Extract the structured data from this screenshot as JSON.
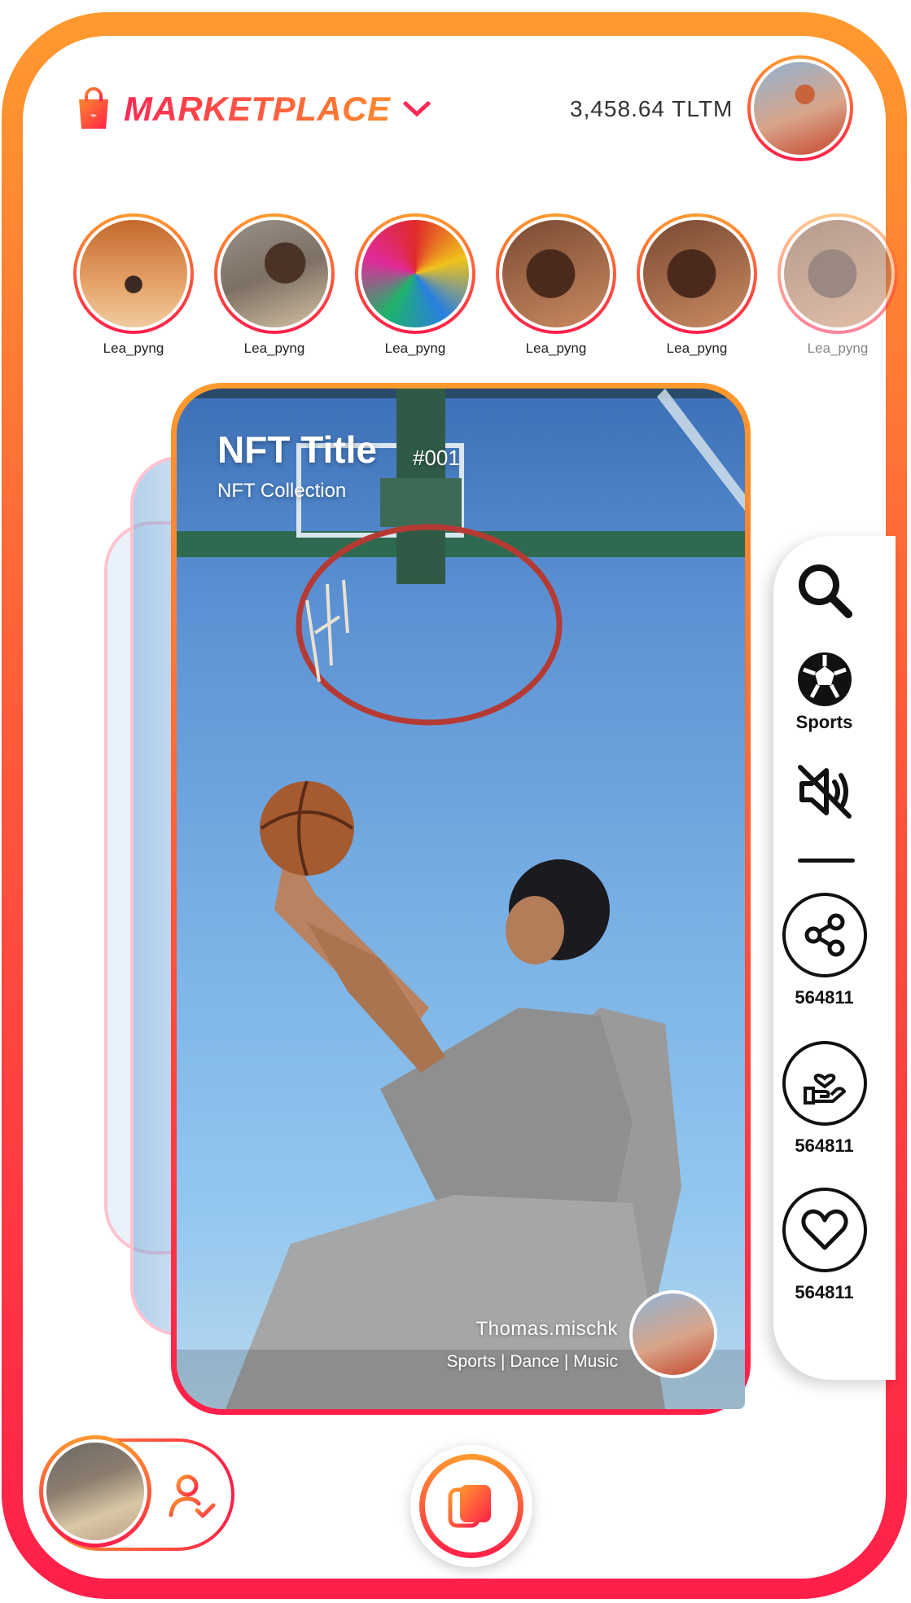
{
  "header": {
    "brand": "MARKETPLACE",
    "balance": "3,458.64 TLTM"
  },
  "stories": [
    {
      "name": "Lea_pyng"
    },
    {
      "name": "Lea_pyng"
    },
    {
      "name": "Lea_pyng"
    },
    {
      "name": "Lea_pyng"
    },
    {
      "name": "Lea_pyng"
    },
    {
      "name": "Lea_pyng"
    }
  ],
  "card": {
    "title": "NFT Title",
    "number": "#001",
    "collection": "NFT Collection",
    "creator": "Thomas.mischk",
    "tags": "Sports | Dance | Music"
  },
  "side": {
    "category_label": "Sports",
    "share_count": "564811",
    "donate_count": "564811",
    "like_count": "564811"
  },
  "colors": {
    "gradient_start": "#ff9a2e",
    "gradient_end": "#ff1f4a",
    "text_dark": "#111111"
  },
  "icons": [
    "bag-icon",
    "chevron-down-icon",
    "search-icon",
    "soccer-ball-icon",
    "mute-icon",
    "share-icon",
    "donate-heart-hand-icon",
    "heart-icon",
    "follow-user-icon",
    "cards-icon"
  ]
}
